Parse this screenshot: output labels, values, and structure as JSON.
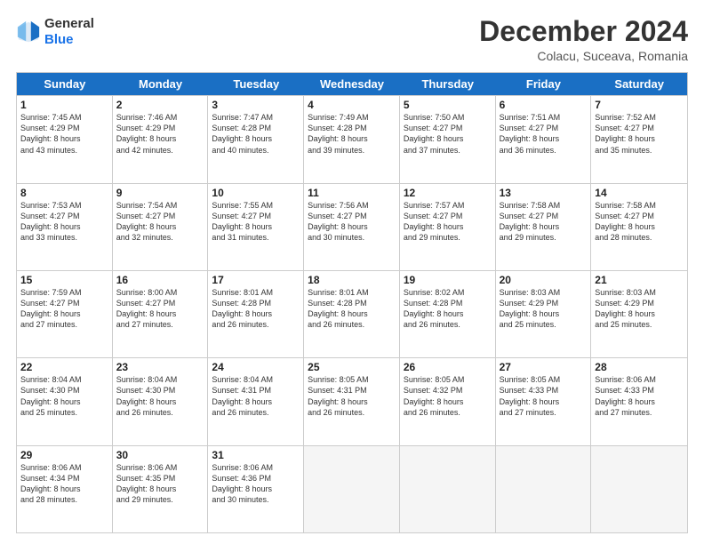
{
  "header": {
    "logo_line1": "General",
    "logo_line2": "Blue",
    "month": "December 2024",
    "location": "Colacu, Suceava, Romania"
  },
  "days_of_week": [
    "Sunday",
    "Monday",
    "Tuesday",
    "Wednesday",
    "Thursday",
    "Friday",
    "Saturday"
  ],
  "weeks": [
    [
      {
        "day": "1",
        "lines": [
          "Sunrise: 7:45 AM",
          "Sunset: 4:29 PM",
          "Daylight: 8 hours",
          "and 43 minutes."
        ]
      },
      {
        "day": "2",
        "lines": [
          "Sunrise: 7:46 AM",
          "Sunset: 4:29 PM",
          "Daylight: 8 hours",
          "and 42 minutes."
        ]
      },
      {
        "day": "3",
        "lines": [
          "Sunrise: 7:47 AM",
          "Sunset: 4:28 PM",
          "Daylight: 8 hours",
          "and 40 minutes."
        ]
      },
      {
        "day": "4",
        "lines": [
          "Sunrise: 7:49 AM",
          "Sunset: 4:28 PM",
          "Daylight: 8 hours",
          "and 39 minutes."
        ]
      },
      {
        "day": "5",
        "lines": [
          "Sunrise: 7:50 AM",
          "Sunset: 4:27 PM",
          "Daylight: 8 hours",
          "and 37 minutes."
        ]
      },
      {
        "day": "6",
        "lines": [
          "Sunrise: 7:51 AM",
          "Sunset: 4:27 PM",
          "Daylight: 8 hours",
          "and 36 minutes."
        ]
      },
      {
        "day": "7",
        "lines": [
          "Sunrise: 7:52 AM",
          "Sunset: 4:27 PM",
          "Daylight: 8 hours",
          "and 35 minutes."
        ]
      }
    ],
    [
      {
        "day": "8",
        "lines": [
          "Sunrise: 7:53 AM",
          "Sunset: 4:27 PM",
          "Daylight: 8 hours",
          "and 33 minutes."
        ]
      },
      {
        "day": "9",
        "lines": [
          "Sunrise: 7:54 AM",
          "Sunset: 4:27 PM",
          "Daylight: 8 hours",
          "and 32 minutes."
        ]
      },
      {
        "day": "10",
        "lines": [
          "Sunrise: 7:55 AM",
          "Sunset: 4:27 PM",
          "Daylight: 8 hours",
          "and 31 minutes."
        ]
      },
      {
        "day": "11",
        "lines": [
          "Sunrise: 7:56 AM",
          "Sunset: 4:27 PM",
          "Daylight: 8 hours",
          "and 30 minutes."
        ]
      },
      {
        "day": "12",
        "lines": [
          "Sunrise: 7:57 AM",
          "Sunset: 4:27 PM",
          "Daylight: 8 hours",
          "and 29 minutes."
        ]
      },
      {
        "day": "13",
        "lines": [
          "Sunrise: 7:58 AM",
          "Sunset: 4:27 PM",
          "Daylight: 8 hours",
          "and 29 minutes."
        ]
      },
      {
        "day": "14",
        "lines": [
          "Sunrise: 7:58 AM",
          "Sunset: 4:27 PM",
          "Daylight: 8 hours",
          "and 28 minutes."
        ]
      }
    ],
    [
      {
        "day": "15",
        "lines": [
          "Sunrise: 7:59 AM",
          "Sunset: 4:27 PM",
          "Daylight: 8 hours",
          "and 27 minutes."
        ]
      },
      {
        "day": "16",
        "lines": [
          "Sunrise: 8:00 AM",
          "Sunset: 4:27 PM",
          "Daylight: 8 hours",
          "and 27 minutes."
        ]
      },
      {
        "day": "17",
        "lines": [
          "Sunrise: 8:01 AM",
          "Sunset: 4:28 PM",
          "Daylight: 8 hours",
          "and 26 minutes."
        ]
      },
      {
        "day": "18",
        "lines": [
          "Sunrise: 8:01 AM",
          "Sunset: 4:28 PM",
          "Daylight: 8 hours",
          "and 26 minutes."
        ]
      },
      {
        "day": "19",
        "lines": [
          "Sunrise: 8:02 AM",
          "Sunset: 4:28 PM",
          "Daylight: 8 hours",
          "and 26 minutes."
        ]
      },
      {
        "day": "20",
        "lines": [
          "Sunrise: 8:03 AM",
          "Sunset: 4:29 PM",
          "Daylight: 8 hours",
          "and 25 minutes."
        ]
      },
      {
        "day": "21",
        "lines": [
          "Sunrise: 8:03 AM",
          "Sunset: 4:29 PM",
          "Daylight: 8 hours",
          "and 25 minutes."
        ]
      }
    ],
    [
      {
        "day": "22",
        "lines": [
          "Sunrise: 8:04 AM",
          "Sunset: 4:30 PM",
          "Daylight: 8 hours",
          "and 25 minutes."
        ]
      },
      {
        "day": "23",
        "lines": [
          "Sunrise: 8:04 AM",
          "Sunset: 4:30 PM",
          "Daylight: 8 hours",
          "and 26 minutes."
        ]
      },
      {
        "day": "24",
        "lines": [
          "Sunrise: 8:04 AM",
          "Sunset: 4:31 PM",
          "Daylight: 8 hours",
          "and 26 minutes."
        ]
      },
      {
        "day": "25",
        "lines": [
          "Sunrise: 8:05 AM",
          "Sunset: 4:31 PM",
          "Daylight: 8 hours",
          "and 26 minutes."
        ]
      },
      {
        "day": "26",
        "lines": [
          "Sunrise: 8:05 AM",
          "Sunset: 4:32 PM",
          "Daylight: 8 hours",
          "and 26 minutes."
        ]
      },
      {
        "day": "27",
        "lines": [
          "Sunrise: 8:05 AM",
          "Sunset: 4:33 PM",
          "Daylight: 8 hours",
          "and 27 minutes."
        ]
      },
      {
        "day": "28",
        "lines": [
          "Sunrise: 8:06 AM",
          "Sunset: 4:33 PM",
          "Daylight: 8 hours",
          "and 27 minutes."
        ]
      }
    ],
    [
      {
        "day": "29",
        "lines": [
          "Sunrise: 8:06 AM",
          "Sunset: 4:34 PM",
          "Daylight: 8 hours",
          "and 28 minutes."
        ]
      },
      {
        "day": "30",
        "lines": [
          "Sunrise: 8:06 AM",
          "Sunset: 4:35 PM",
          "Daylight: 8 hours",
          "and 29 minutes."
        ]
      },
      {
        "day": "31",
        "lines": [
          "Sunrise: 8:06 AM",
          "Sunset: 4:36 PM",
          "Daylight: 8 hours",
          "and 30 minutes."
        ]
      },
      {
        "day": "",
        "lines": []
      },
      {
        "day": "",
        "lines": []
      },
      {
        "day": "",
        "lines": []
      },
      {
        "day": "",
        "lines": []
      }
    ]
  ]
}
